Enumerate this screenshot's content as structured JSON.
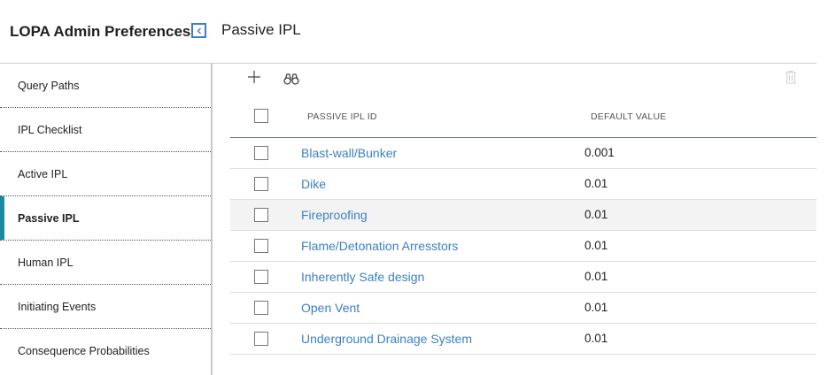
{
  "header": {
    "app_title": "LOPA Admin Preferences",
    "page_title": "Passive IPL"
  },
  "sidebar": {
    "items": [
      {
        "label": "Query Paths",
        "active": false
      },
      {
        "label": "IPL Checklist",
        "active": false
      },
      {
        "label": "Active IPL",
        "active": false
      },
      {
        "label": "Passive IPL",
        "active": true
      },
      {
        "label": "Human IPL",
        "active": false
      },
      {
        "label": "Initiating Events",
        "active": false
      },
      {
        "label": "Consequence Probabilities",
        "active": false
      }
    ]
  },
  "toolbar": {
    "add_icon": "plus-icon",
    "find_icon": "binoculars-icon",
    "delete_icon": "trash-icon"
  },
  "grid": {
    "columns": [
      "PASSIVE IPL ID",
      "DEFAULT VALUE"
    ],
    "rows": [
      {
        "id": "Blast-wall/Bunker",
        "value": "0.001"
      },
      {
        "id": "Dike",
        "value": "0.01"
      },
      {
        "id": "Fireproofing",
        "value": "0.01"
      },
      {
        "id": "Flame/Detonation Arresstors",
        "value": "0.01"
      },
      {
        "id": "Inherently Safe design",
        "value": "0.01"
      },
      {
        "id": "Open Vent",
        "value": "0.01"
      },
      {
        "id": "Underground Drainage System",
        "value": "0.01"
      }
    ]
  },
  "colors": {
    "accent": "#1a8a9e",
    "link": "#3b7fc4",
    "collapse_border": "#3a7fcc"
  }
}
